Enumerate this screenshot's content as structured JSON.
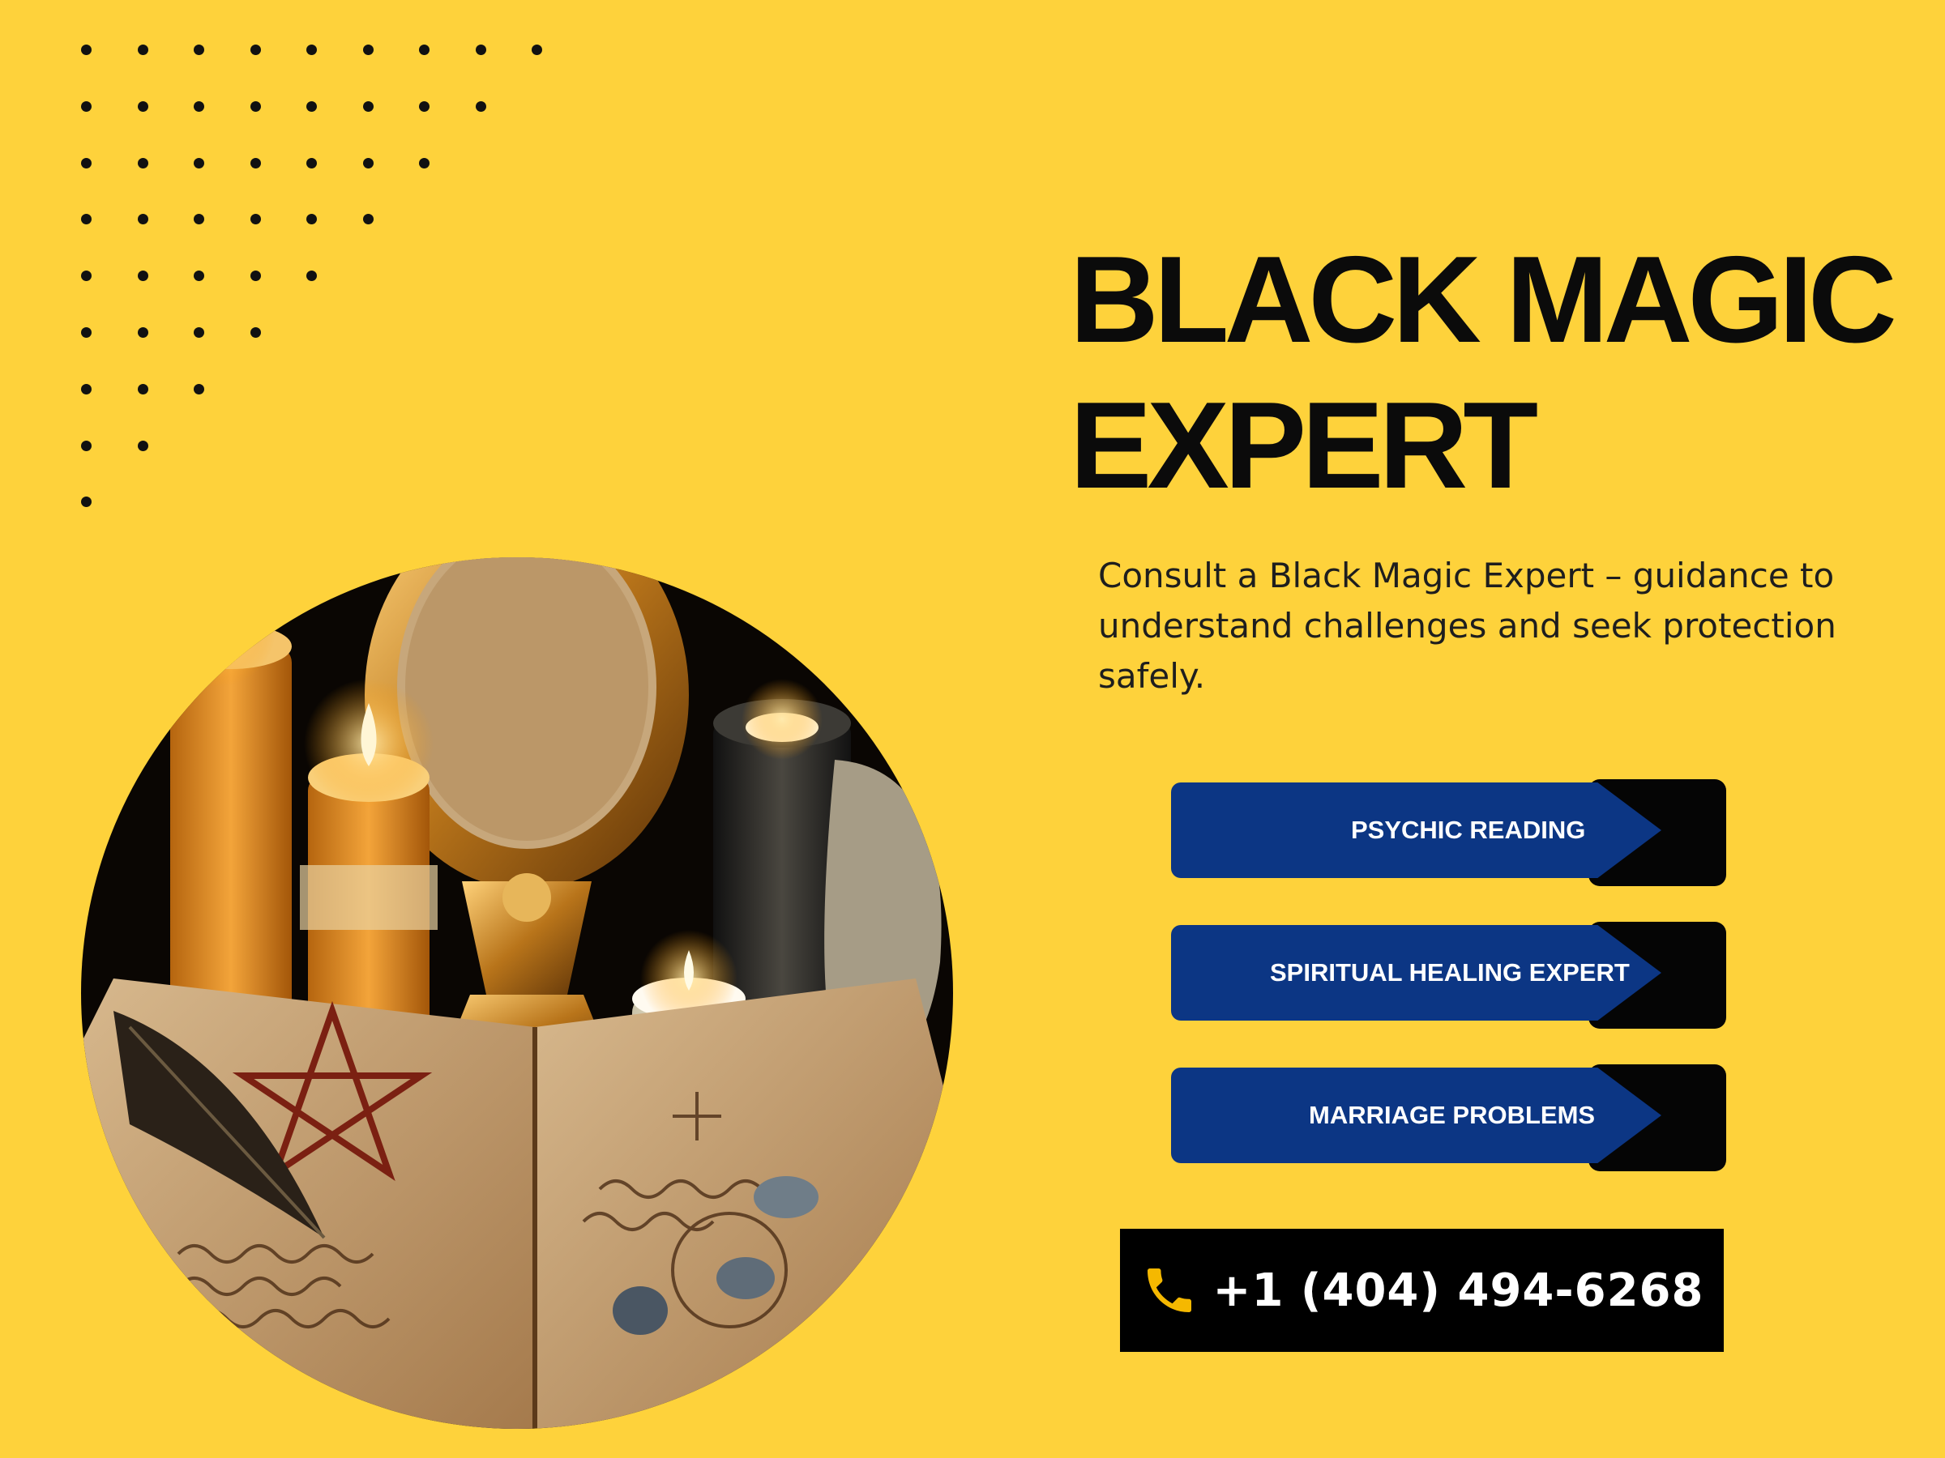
{
  "hero": {
    "title_line1": "BLACK MAGIC",
    "title_line2": "EXPERT",
    "description": "Consult a Black Magic Expert – guidance to understand challenges and seek protection safely."
  },
  "services": [
    {
      "label": "PSYCHIC READING",
      "icon": "arrow-tab"
    },
    {
      "label": "SPIRITUAL HEALING EXPERT",
      "icon": "arrow-tab"
    },
    {
      "label": "MARRIAGE PROBLEMS",
      "icon": "arrow-tab"
    }
  ],
  "contact": {
    "phone": "+1 (404) 494-6268",
    "icon": "phone-icon"
  },
  "colors": {
    "background": "#fed23b",
    "button_blue": "#0c3684",
    "button_dark": "#050505",
    "phone_icon": "#f5b800",
    "text": "#0b0b0b"
  },
  "image": {
    "subject": "candles, ornate mirror, open spell book with pentagram, feather and rune stones"
  }
}
